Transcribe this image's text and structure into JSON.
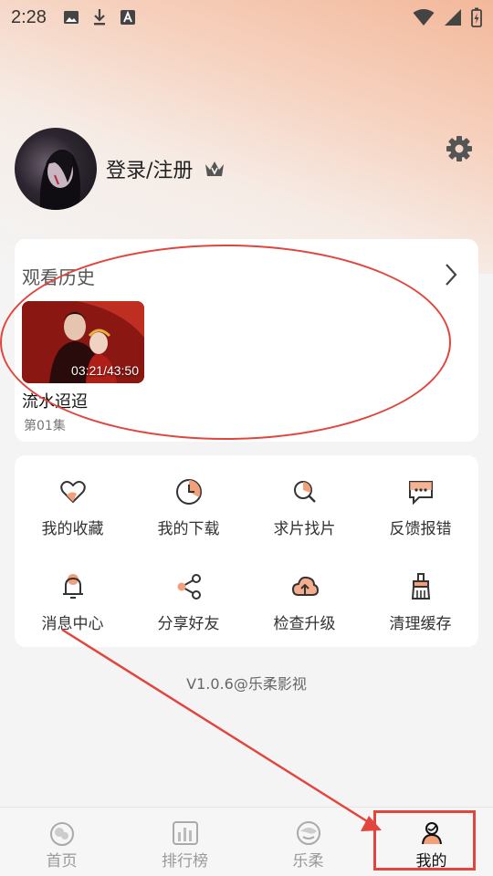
{
  "status_bar": {
    "time": "2:28",
    "left_icons": [
      "image-icon",
      "download-icon",
      "a-badge-icon"
    ],
    "right_icons": [
      "wifi-icon",
      "signal-icon",
      "battery-charging-icon"
    ]
  },
  "profile": {
    "login_label": "登录/注册",
    "crown_icon": "crown-icon",
    "settings_icon": "gear-icon"
  },
  "history": {
    "title": "观看历史",
    "item": {
      "progress_text": "03:21/43:50",
      "show_title": "流水迢迢",
      "episode": "第01集"
    }
  },
  "menu": {
    "items": [
      {
        "label": "我的收藏",
        "icon": "heart-icon"
      },
      {
        "label": "我的下载",
        "icon": "download-clock-icon"
      },
      {
        "label": "求片找片",
        "icon": "search-film-icon"
      },
      {
        "label": "反馈报错",
        "icon": "feedback-icon"
      },
      {
        "label": "消息中心",
        "icon": "bell-icon"
      },
      {
        "label": "分享好友",
        "icon": "share-icon"
      },
      {
        "label": "检查升级",
        "icon": "cloud-upload-icon"
      },
      {
        "label": "清理缓存",
        "icon": "broom-icon"
      }
    ]
  },
  "version": "V1.0.6@乐柔影视",
  "tabbar": {
    "tabs": [
      {
        "label": "首页",
        "icon": "home-icon",
        "active": false
      },
      {
        "label": "排行榜",
        "icon": "ranking-icon",
        "active": false
      },
      {
        "label": "乐柔",
        "icon": "lerou-icon",
        "active": false
      },
      {
        "label": "我的",
        "icon": "profile-icon",
        "active": true
      }
    ]
  },
  "colors": {
    "accent": "#f2a07a",
    "annotation": "#e2453d",
    "card_bg": "#ffffff",
    "page_bg": "#f4f4f4"
  }
}
